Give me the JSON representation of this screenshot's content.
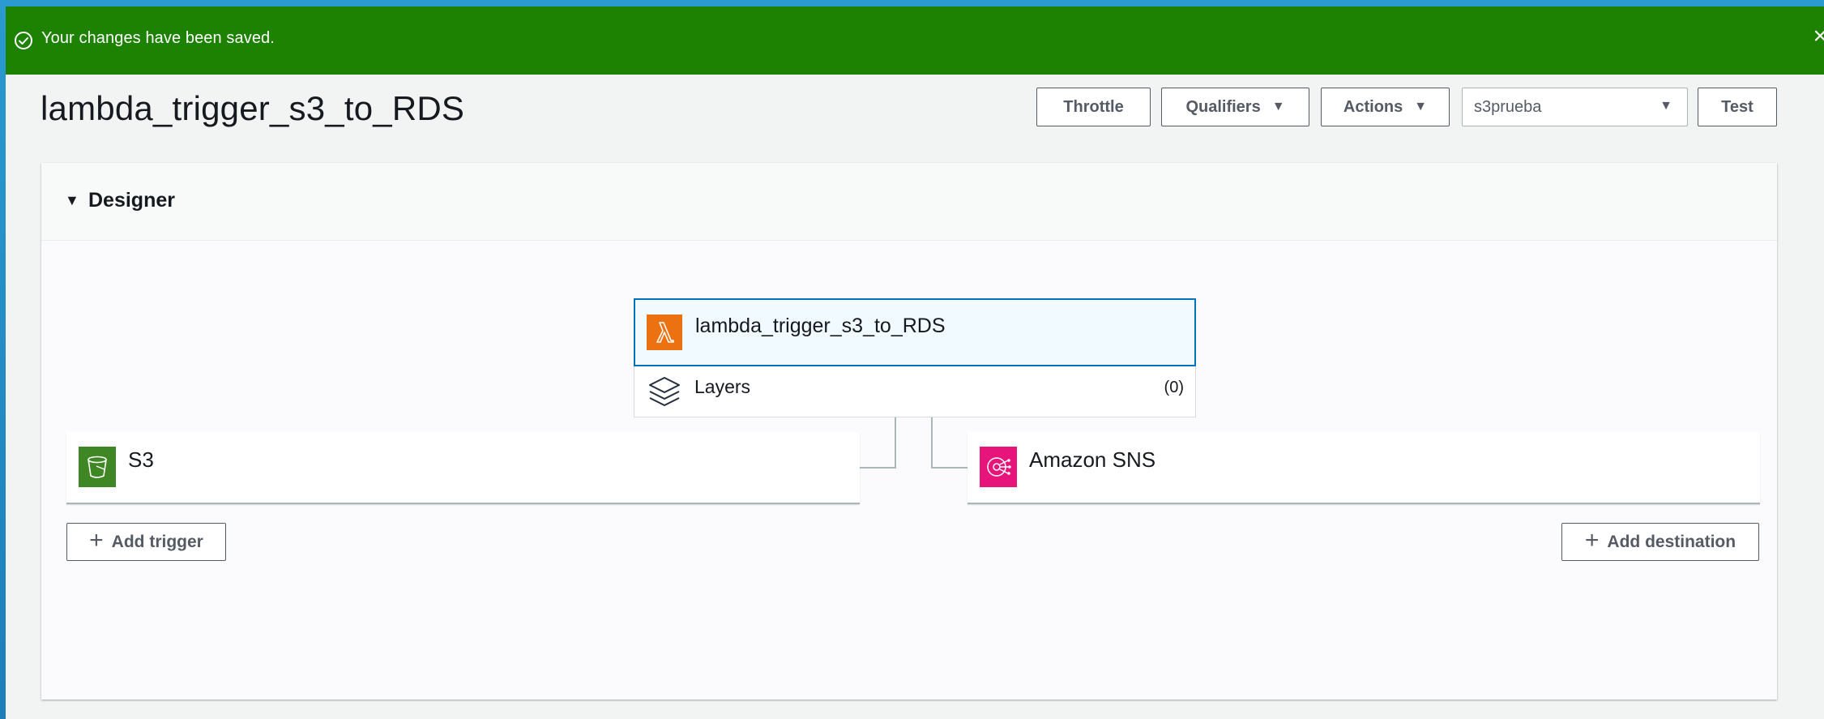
{
  "flash": {
    "message": "Your changes have been saved.",
    "close_glyph": "×",
    "color": "#1d8102"
  },
  "header": {
    "function_title": "lambda_trigger_s3_to_RDS",
    "buttons": {
      "throttle": "Throttle",
      "qualifiers": "Qualifiers",
      "actions": "Actions",
      "test": "Test"
    },
    "test_event_select": {
      "value": "s3prueba"
    },
    "caret_glyph": "▼"
  },
  "designer": {
    "title": "Designer",
    "toggle_glyph": "▼",
    "function_card": {
      "name": "lambda_trigger_s3_to_RDS",
      "icon": "lambda-icon",
      "color": "#ec7211"
    },
    "layers": {
      "label": "Layers",
      "count": "(0)",
      "icon": "layers-icon"
    },
    "trigger": {
      "label": "S3",
      "icon": "s3-bucket-icon",
      "color": "#3f8624"
    },
    "destination": {
      "label": "Amazon SNS",
      "icon": "sns-icon",
      "color": "#e7157b"
    },
    "add_trigger": {
      "plus": "+",
      "label": "Add trigger"
    },
    "add_destination": {
      "plus": "+",
      "label": "Add destination"
    }
  }
}
